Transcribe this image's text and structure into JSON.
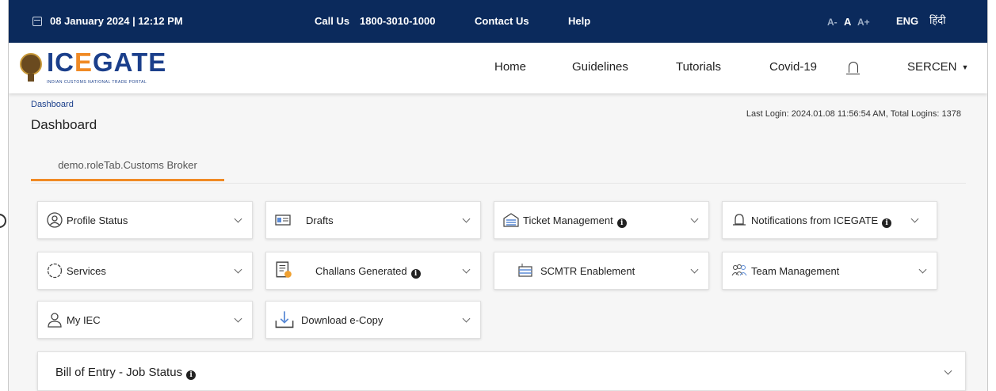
{
  "topbar": {
    "datetime": "08 January 2024 | 12:12 PM",
    "call_label": "Call Us",
    "call_number": "1800-3010-1000",
    "contact": "Contact Us",
    "help": "Help",
    "font_small": "A-",
    "font_normal": "A",
    "font_large": "A+",
    "lang_en": "ENG",
    "lang_hi": "हिंदी"
  },
  "brand": {
    "name_part1": "IC",
    "name_accent": "E",
    "name_part2": "GATE",
    "tagline": "INDIAN CUSTOMS NATIONAL TRADE PORTAL"
  },
  "nav": {
    "home": "Home",
    "guidelines": "Guidelines",
    "tutorials": "Tutorials",
    "covid": "Covid-19",
    "user": "SERCEN"
  },
  "page": {
    "breadcrumb": "Dashboard",
    "title": "Dashboard",
    "last_login": "Last Login: 2024.01.08 11:56:54 AM, Total Logins: 1378"
  },
  "role_tab": "demo.roleTab.Customs Broker",
  "cards": {
    "profile_status": "Profile Status",
    "drafts": "Drafts",
    "ticket_management": "Ticket Management",
    "notifications": "Notifications from ICEGATE",
    "services": "Services",
    "challans": "Challans Generated",
    "scmtr": "SCMTR Enablement",
    "team": "Team Management",
    "my_iec": "My IEC",
    "download": "Download e-Copy"
  },
  "boe": {
    "title": "Bill of Entry - Job Status"
  },
  "colors": {
    "topbar": "#0b2a5c",
    "brand_blue": "#1b3f8b",
    "accent": "#f08a24"
  }
}
